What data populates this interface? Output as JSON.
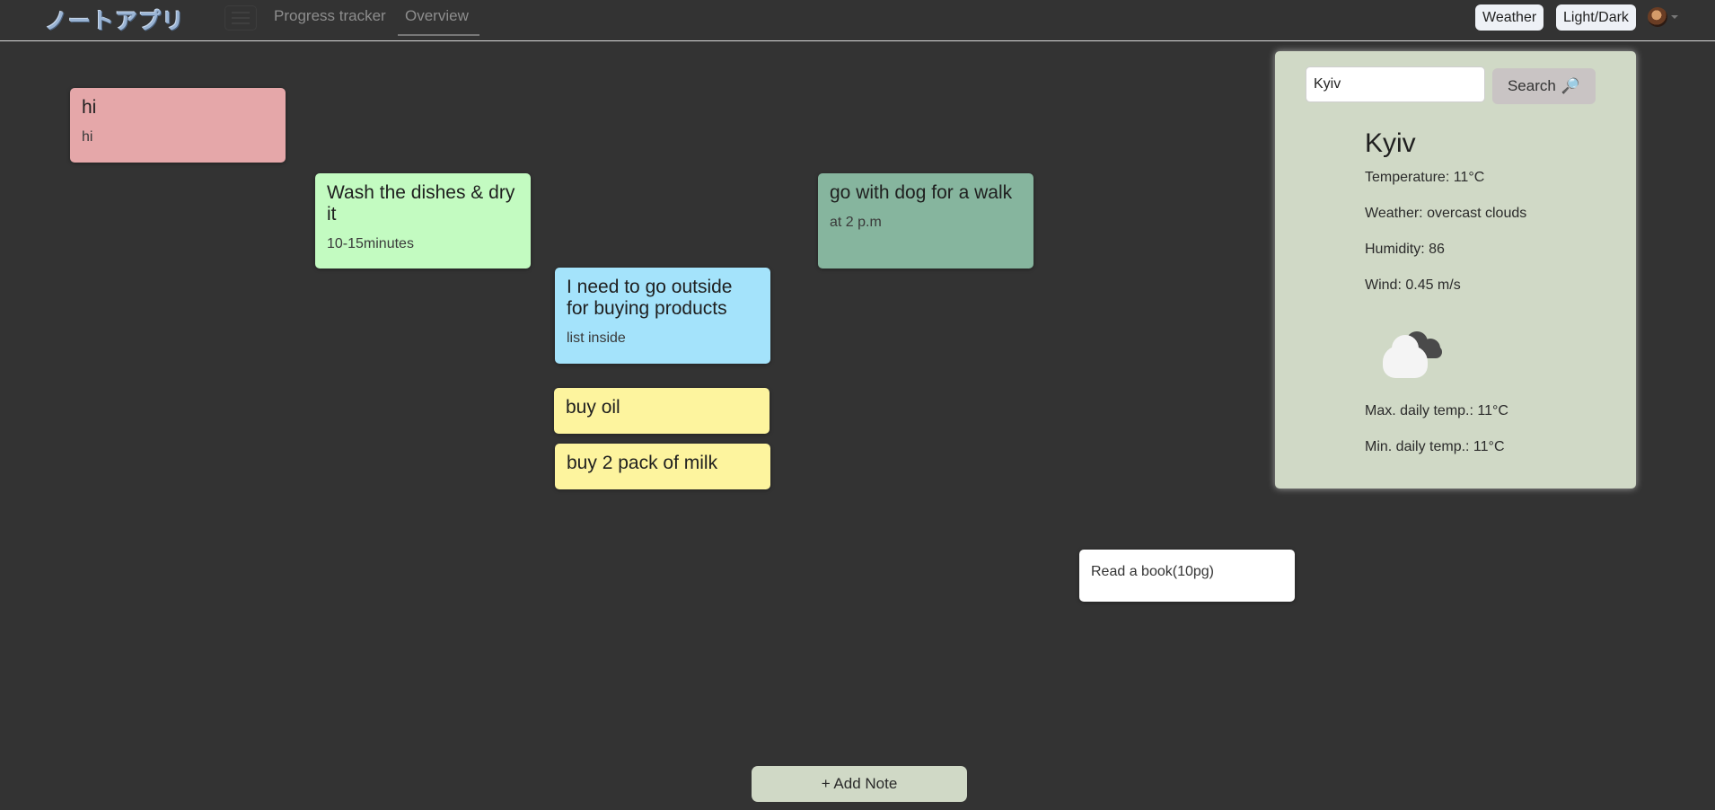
{
  "header": {
    "brand": "ノートアプリ",
    "nav": {
      "progress": "Progress tracker",
      "overview": "Overview"
    },
    "buttons": {
      "weather": "Weather",
      "theme": "Light/Dark"
    }
  },
  "notes": [
    {
      "title": "hi",
      "body": "hi",
      "color": "#e5a7a9"
    },
    {
      "title": "Wash the dishes & dry it",
      "body": "10-15minutes",
      "color": "#c3fbc1"
    },
    {
      "title": "go with dog for a walk",
      "body": "at 2 p.m",
      "color": "#86b59e"
    },
    {
      "title": "I need to go outside for buying products",
      "body": "list inside",
      "color": "#a4e3fb"
    },
    {
      "title": "buy oil",
      "body": "",
      "color": "#fdf49e"
    },
    {
      "title": "buy 2 pack of milk",
      "body": "",
      "color": "#fdf49e"
    },
    {
      "title": "",
      "body": "Read a book(10pg)",
      "color": "#ffffff"
    }
  ],
  "weather": {
    "input_value": "Kyiv",
    "search_label": "Search",
    "search_icon": "🔎",
    "city": "Kyiv",
    "temperature": "Temperature: 11°C",
    "description": "Weather: overcast clouds",
    "humidity": "Humidity: 86",
    "wind": "Wind: 0.45 m/s",
    "icon": "overcast-cloud-icon",
    "max_temp": "Max. daily temp.: 11°C",
    "min_temp": "Min. daily temp.: 11°C"
  },
  "add_note_label": "+ Add Note"
}
